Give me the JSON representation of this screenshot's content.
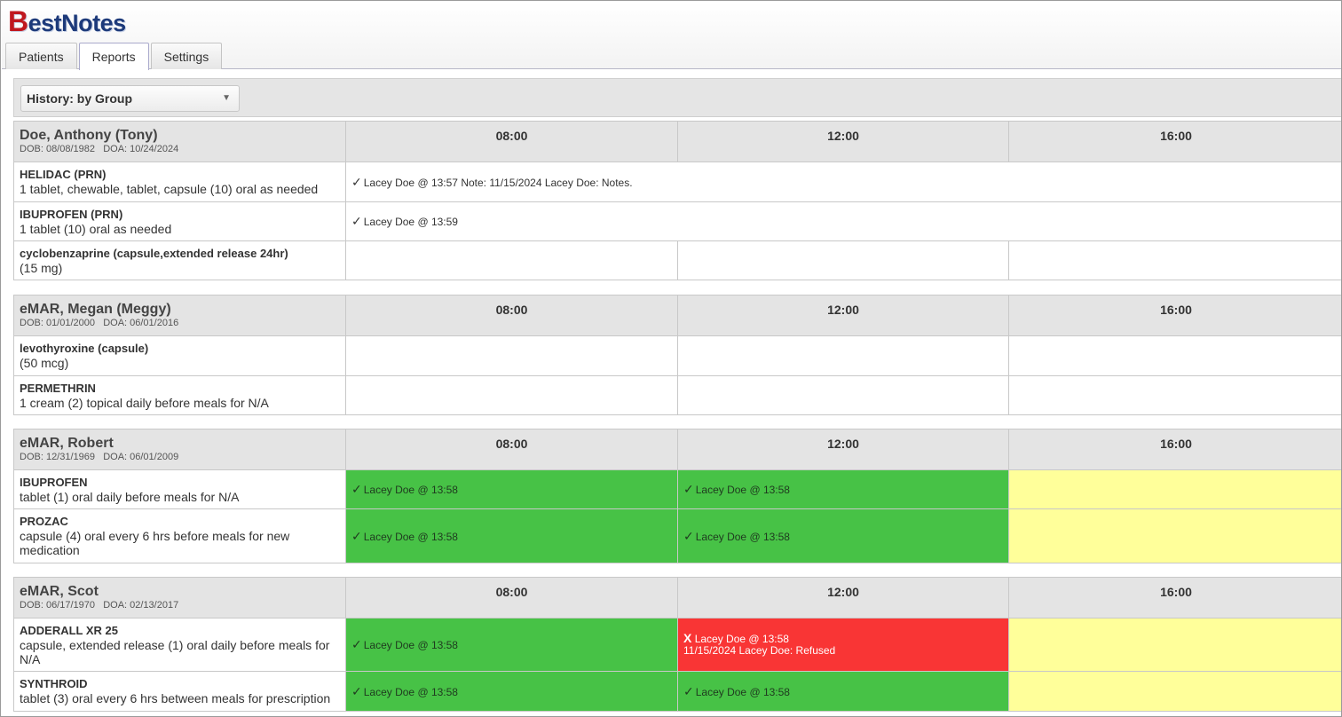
{
  "app": {
    "logo_first": "B",
    "logo_rest": "estNotes"
  },
  "tabs": [
    {
      "label": "Patients"
    },
    {
      "label": "Reports"
    },
    {
      "label": "Settings"
    }
  ],
  "toolbar": {
    "report_select": "History: by Group"
  },
  "time_slots": [
    "08:00",
    "12:00",
    "16:00"
  ],
  "patients": [
    {
      "name": "Doe, Anthony (Tony)",
      "dob_label": "DOB: 08/08/1982",
      "doa_label": "DOA: 10/24/2024",
      "meds": [
        {
          "name": "HELIDAC   (PRN)",
          "desc": "1 tablet, chewable, tablet, capsule (10) oral as needed",
          "entry": "Lacey Doe @ 13:57 Note: 11/15/2024 Lacey Doe: Notes."
        },
        {
          "name": "IBUPROFEN   (PRN)",
          "desc": "1 tablet (10) oral as needed",
          "entry": "Lacey Doe @ 13:59"
        },
        {
          "name": "cyclobenzaprine (capsule,extended release 24hr)",
          "desc": "(15 mg)"
        }
      ]
    },
    {
      "name": "eMAR, Megan (Meggy)",
      "dob_label": "DOB: 01/01/2000",
      "doa_label": "DOA: 06/01/2016",
      "meds": [
        {
          "name": "levothyroxine (capsule)",
          "desc": "(50 mcg)"
        },
        {
          "name": "PERMETHRIN",
          "desc": "1 cream (2) topical daily before meals for N/A"
        }
      ]
    },
    {
      "name": "eMAR, Robert",
      "dob_label": "DOB: 12/31/1969",
      "doa_label": "DOA: 06/01/2009",
      "meds": [
        {
          "name": "IBUPROFEN",
          "desc": "tablet (1) oral daily before meals for N/A",
          "slot1": "Lacey Doe @ 13:58",
          "slot2": "Lacey Doe @ 13:58"
        },
        {
          "name": "PROZAC",
          "desc": "capsule (4) oral every 6 hrs before meals for new medication",
          "slot1": "Lacey Doe @ 13:58",
          "slot2": "Lacey Doe @ 13:58"
        }
      ]
    },
    {
      "name": "eMAR, Scot",
      "dob_label": "DOB: 06/17/1970",
      "doa_label": "DOA: 02/13/2017",
      "meds": [
        {
          "name": "ADDERALL XR 25",
          "desc": "capsule, extended release (1) oral daily before meals for N/A",
          "slot1": "Lacey Doe @ 13:58",
          "slot2_line1": "Lacey Doe @ 13:58",
          "slot2_line2": "11/15/2024 Lacey Doe: Refused"
        },
        {
          "name": "SYNTHROID",
          "desc": "tablet (3) oral every 6 hrs between meals for prescription",
          "slot1": "Lacey Doe @ 13:58",
          "slot2": "Lacey Doe @ 13:58"
        }
      ]
    }
  ],
  "icons": {
    "given": "checkmark-icon",
    "refused": "x-icon",
    "dropdown": "chevron-down-icon"
  },
  "colors": {
    "given": "#47c246",
    "pending": "#ffff9a",
    "refused": "#f93535",
    "header": "#e4e4e4"
  }
}
